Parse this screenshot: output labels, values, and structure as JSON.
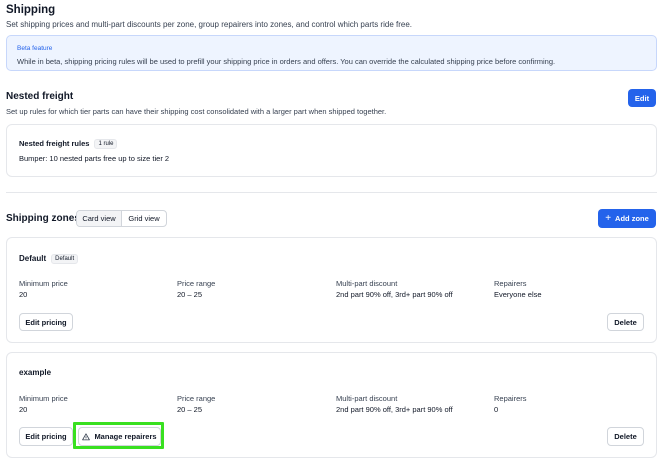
{
  "header": {
    "title": "Shipping",
    "subtitle": "Set shipping prices and multi-part discounts per zone, group repairers into zones, and control which parts ride free."
  },
  "beta_notice": {
    "title": "Beta feature",
    "text": "While in beta, shipping pricing rules will be used to prefill your shipping price in orders and offers. You can override the calculated shipping price before confirming."
  },
  "nested_freight": {
    "title": "Nested freight",
    "subtitle": "Set up rules for which tier parts can have their shipping cost consolidated with a larger part when shipped together.",
    "edit_label": "Edit",
    "rules_title": "Nested freight rules",
    "rules_count": "1 rule",
    "rule_line": "Bumper: 10 nested parts free up to size tier 2"
  },
  "zones": {
    "title": "Shipping zones",
    "view_options": [
      "Card view",
      "Grid view"
    ],
    "active_view": "Card view",
    "add_label": "Add zone",
    "columns": [
      "Minimum price",
      "Price range",
      "Multi-part discount",
      "Repairers"
    ],
    "items": [
      {
        "name": "Default",
        "badge": "Default",
        "minimum_price": "20",
        "price_range": "20 – 25",
        "discount": "2nd part 90% off, 3rd+ part 90% off",
        "repairers": "Everyone else",
        "edit_label": "Edit pricing",
        "delete_label": "Delete"
      },
      {
        "name": "example",
        "minimum_price": "20",
        "price_range": "20 – 25",
        "discount": "2nd part 90% off, 3rd+ part 90% off",
        "repairers": "0",
        "edit_label": "Edit pricing",
        "manage_label": "Manage repairers",
        "delete_label": "Delete"
      }
    ]
  },
  "colors": {
    "accent": "#2463eb",
    "beta_bg": "#eef4ff",
    "highlight": "#39e020"
  }
}
